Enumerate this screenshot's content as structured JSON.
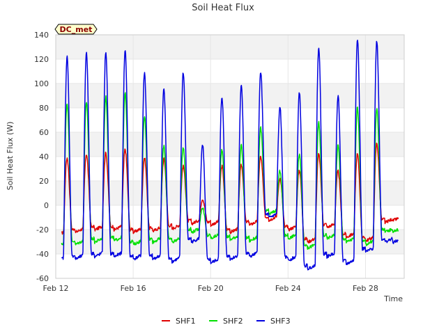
{
  "chart_data": {
    "type": "line",
    "title": "Soil Heat Flux",
    "xlabel": "Time",
    "ylabel": "Soil Heat Flux (W)",
    "site_badge": "DC_met",
    "x_range_days": [
      0,
      18
    ],
    "ylim": [
      -60,
      140
    ],
    "yticks": [
      -60,
      -40,
      -20,
      0,
      20,
      40,
      60,
      80,
      100,
      120,
      140
    ],
    "xticks": [
      {
        "day": 0,
        "label": "Feb 12"
      },
      {
        "day": 4,
        "label": "Feb 16"
      },
      {
        "day": 8,
        "label": "Feb 20"
      },
      {
        "day": 12,
        "label": "Feb 24"
      },
      {
        "day": 16,
        "label": "Feb 28"
      }
    ],
    "grid": true,
    "legend_position": "bottom-center",
    "series": [
      {
        "name": "SHF1",
        "color": "#e00000",
        "day_start": 0.3,
        "nights": [
          -23,
          -20,
          -18,
          -18,
          -20,
          -19,
          -17,
          -13,
          -14,
          -20,
          -14,
          -10,
          -18,
          -28,
          -16,
          -24,
          -27,
          -12,
          -10
        ],
        "peaks": [
          39,
          42,
          43,
          46,
          39,
          38,
          32,
          5,
          32,
          33,
          40,
          22,
          29,
          42,
          28,
          42,
          51
        ]
      },
      {
        "name": "SHF2",
        "color": "#00e000",
        "day_start": 0.3,
        "nights": [
          -32,
          -30,
          -28,
          -27,
          -30,
          -28,
          -28,
          -20,
          -25,
          -26,
          -27,
          -5,
          -25,
          -33,
          -25,
          -28,
          -30,
          -20,
          -19
        ],
        "peaks": [
          84,
          85,
          89,
          92,
          73,
          49,
          48,
          -2,
          46,
          49,
          64,
          28,
          42,
          68,
          49,
          80,
          79
        ]
      },
      {
        "name": "SHF3",
        "color": "#0000e0",
        "day_start": 0.3,
        "nights": [
          -44,
          -42,
          -40,
          -40,
          -42,
          -42,
          -44,
          -28,
          -45,
          -42,
          -40,
          -8,
          -43,
          -50,
          -40,
          -46,
          -36,
          -28,
          -28
        ],
        "peaks": [
          122,
          126,
          126,
          128,
          109,
          96,
          109,
          49,
          89,
          98,
          110,
          80,
          93,
          130,
          90,
          137,
          135
        ]
      }
    ]
  }
}
